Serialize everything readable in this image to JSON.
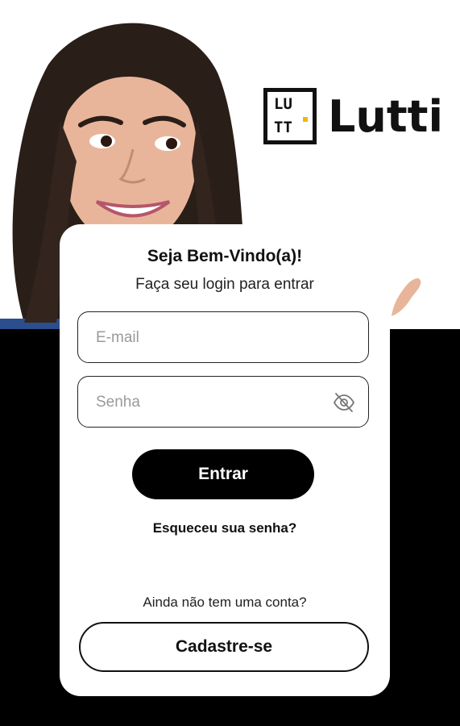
{
  "brand": {
    "logo_mark_line1": "LU",
    "logo_mark_line2": "TT",
    "name": "Lutti",
    "accent": "#f2b705"
  },
  "login": {
    "title": "Seja Bem-Vindo(a)!",
    "subtitle": "Faça seu login para entrar",
    "email_placeholder": "E-mail",
    "password_placeholder": "Senha",
    "password_toggle_icon": "eye-off-icon",
    "submit_label": "Entrar",
    "forgot_label": "Esqueceu sua senha?",
    "no_account_text": "Ainda não tem uma conta?",
    "signup_label": "Cadastre-se"
  },
  "colors": {
    "background_bottom": "#000000",
    "card": "#ffffff",
    "primary_button": "#000000"
  }
}
